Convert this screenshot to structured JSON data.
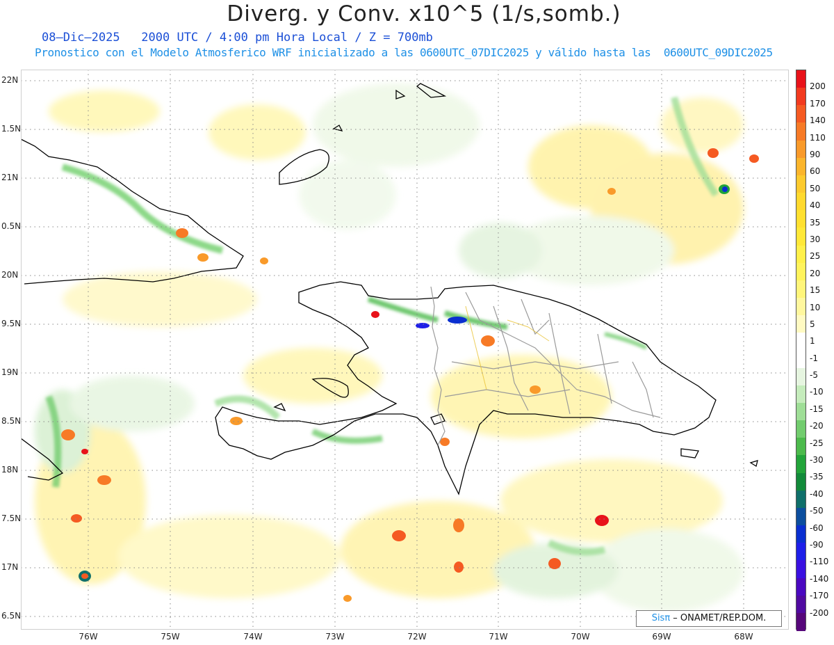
{
  "title": "Diverg. y Conv. x10^5 (1/s,somb.)",
  "subtitle_date": "08–Dic–2025   2000 UTC / 4:00 pm Hora Local / Z = 700mb",
  "subtitle_model": "Pronostico con el Modelo Atmosferico WRF inicializado a las 0600UTC_07DIC2025 y válido hasta las  0600UTC_09DIC2025",
  "lat_labels": [
    "22N",
    "1.5N",
    "21N",
    "0.5N",
    "20N",
    "9.5N",
    "19N",
    "8.5N",
    "18N",
    "7.5N",
    "17N",
    "6.5N"
  ],
  "lon_labels": [
    "76W",
    "75W",
    "74W",
    "73W",
    "72W",
    "71W",
    "70W",
    "69W",
    "68W"
  ],
  "legend_labels": [
    "200",
    "170",
    "140",
    "110",
    "90",
    "60",
    "50",
    "40",
    "35",
    "30",
    "25",
    "20",
    "15",
    "10",
    "5",
    "1",
    "-1",
    "-5",
    "-10",
    "-15",
    "-20",
    "-25",
    "-30",
    "-35",
    "-40",
    "-50",
    "-60",
    "-90",
    "-110",
    "-140",
    "-170",
    "-200"
  ],
  "legend_colors": [
    "#e8121a",
    "#f23a1f",
    "#f55a22",
    "#f77a26",
    "#f99a2a",
    "#fbb52c",
    "#fdca2e",
    "#ffd92e",
    "#ffe030",
    "#ffe838",
    "#fff04a",
    "#fff35c",
    "#fff57a",
    "#fff79e",
    "#fffac2",
    "#ffffff",
    "#ffffff",
    "#e6f5e0",
    "#c5ecbc",
    "#9fde97",
    "#72cc6e",
    "#4cba4c",
    "#22a43a",
    "#128a3a",
    "#0f6f6a",
    "#0c4e9e",
    "#0a2fd0",
    "#1e1fe8",
    "#3a10e0",
    "#4a08c0",
    "#500aa0",
    "#56077a"
  ],
  "credit": {
    "brand": "Sisπ",
    "text": " – ONAMET/REP.DOM."
  }
}
